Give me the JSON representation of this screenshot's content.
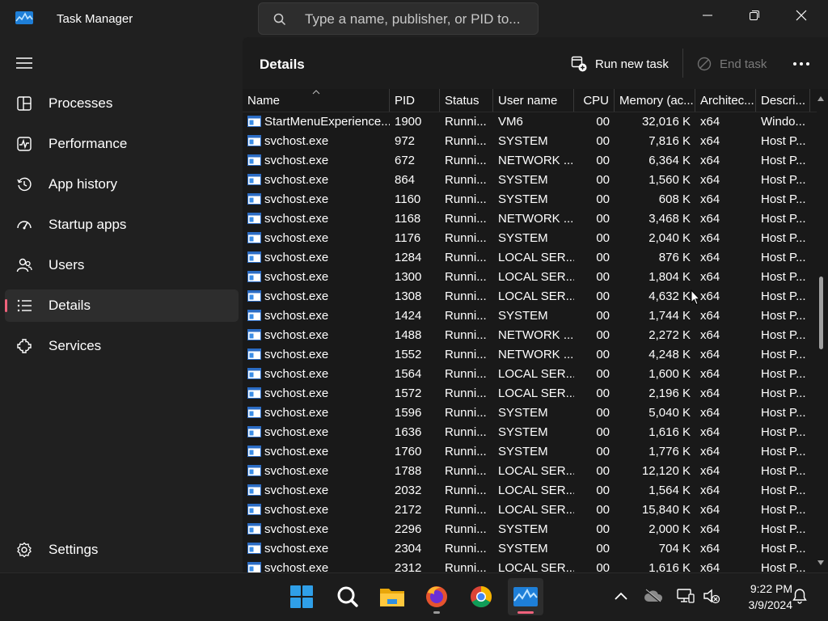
{
  "window": {
    "title": "Task Manager",
    "search_placeholder": "Type a name, publisher, or PID to...",
    "controls": [
      "minimize",
      "restore",
      "close"
    ]
  },
  "sidebar": {
    "items": [
      {
        "label": "Processes",
        "icon": "processes-icon",
        "active": false
      },
      {
        "label": "Performance",
        "icon": "performance-icon",
        "active": false
      },
      {
        "label": "App history",
        "icon": "app-history-icon",
        "active": false
      },
      {
        "label": "Startup apps",
        "icon": "startup-apps-icon",
        "active": false
      },
      {
        "label": "Users",
        "icon": "users-icon",
        "active": false
      },
      {
        "label": "Details",
        "icon": "details-icon",
        "active": true
      },
      {
        "label": "Services",
        "icon": "services-icon",
        "active": false
      }
    ],
    "settings_label": "Settings"
  },
  "main": {
    "title": "Details",
    "run_new_task_label": "Run new task",
    "end_task_label": "End task",
    "more_icon": "more-icon"
  },
  "table": {
    "columns": [
      "Name",
      "PID",
      "Status",
      "User name",
      "CPU",
      "Memory (ac...",
      "Architec...",
      "Descri..."
    ],
    "rows": [
      [
        "StartMenuExperience...",
        "1900",
        "Runni...",
        "VM6",
        "00",
        "32,016 K",
        "x64",
        "Windo..."
      ],
      [
        "svchost.exe",
        "972",
        "Runni...",
        "SYSTEM",
        "00",
        "7,816 K",
        "x64",
        "Host P..."
      ],
      [
        "svchost.exe",
        "672",
        "Runni...",
        "NETWORK ...",
        "00",
        "6,364 K",
        "x64",
        "Host P..."
      ],
      [
        "svchost.exe",
        "864",
        "Runni...",
        "SYSTEM",
        "00",
        "1,560 K",
        "x64",
        "Host P..."
      ],
      [
        "svchost.exe",
        "1160",
        "Runni...",
        "SYSTEM",
        "00",
        "608 K",
        "x64",
        "Host P..."
      ],
      [
        "svchost.exe",
        "1168",
        "Runni...",
        "NETWORK ...",
        "00",
        "3,468 K",
        "x64",
        "Host P..."
      ],
      [
        "svchost.exe",
        "1176",
        "Runni...",
        "SYSTEM",
        "00",
        "2,040 K",
        "x64",
        "Host P..."
      ],
      [
        "svchost.exe",
        "1284",
        "Runni...",
        "LOCAL SER...",
        "00",
        "876 K",
        "x64",
        "Host P..."
      ],
      [
        "svchost.exe",
        "1300",
        "Runni...",
        "LOCAL SER...",
        "00",
        "1,804 K",
        "x64",
        "Host P..."
      ],
      [
        "svchost.exe",
        "1308",
        "Runni...",
        "LOCAL SER...",
        "00",
        "4,632 K",
        "x64",
        "Host P..."
      ],
      [
        "svchost.exe",
        "1424",
        "Runni...",
        "SYSTEM",
        "00",
        "1,744 K",
        "x64",
        "Host P..."
      ],
      [
        "svchost.exe",
        "1488",
        "Runni...",
        "NETWORK ...",
        "00",
        "2,272 K",
        "x64",
        "Host P..."
      ],
      [
        "svchost.exe",
        "1552",
        "Runni...",
        "NETWORK ...",
        "00",
        "4,248 K",
        "x64",
        "Host P..."
      ],
      [
        "svchost.exe",
        "1564",
        "Runni...",
        "LOCAL SER...",
        "00",
        "1,600 K",
        "x64",
        "Host P..."
      ],
      [
        "svchost.exe",
        "1572",
        "Runni...",
        "LOCAL SER...",
        "00",
        "2,196 K",
        "x64",
        "Host P..."
      ],
      [
        "svchost.exe",
        "1596",
        "Runni...",
        "SYSTEM",
        "00",
        "5,040 K",
        "x64",
        "Host P..."
      ],
      [
        "svchost.exe",
        "1636",
        "Runni...",
        "SYSTEM",
        "00",
        "1,616 K",
        "x64",
        "Host P..."
      ],
      [
        "svchost.exe",
        "1760",
        "Runni...",
        "SYSTEM",
        "00",
        "1,776 K",
        "x64",
        "Host P..."
      ],
      [
        "svchost.exe",
        "1788",
        "Runni...",
        "LOCAL SER...",
        "00",
        "12,120 K",
        "x64",
        "Host P..."
      ],
      [
        "svchost.exe",
        "2032",
        "Runni...",
        "LOCAL SER...",
        "00",
        "1,564 K",
        "x64",
        "Host P..."
      ],
      [
        "svchost.exe",
        "2172",
        "Runni...",
        "LOCAL SER...",
        "00",
        "15,840 K",
        "x64",
        "Host P..."
      ],
      [
        "svchost.exe",
        "2296",
        "Runni...",
        "SYSTEM",
        "00",
        "2,000 K",
        "x64",
        "Host P..."
      ],
      [
        "svchost.exe",
        "2304",
        "Runni...",
        "SYSTEM",
        "00",
        "704 K",
        "x64",
        "Host P..."
      ],
      [
        "svchost.exe",
        "2312",
        "Runni...",
        "LOCAL SER...",
        "00",
        "1,616 K",
        "x64",
        "Host P..."
      ]
    ]
  },
  "taskbar": {
    "apps": [
      {
        "icon": "windows-start-icon",
        "active": false
      },
      {
        "icon": "search-icon",
        "active": false
      },
      {
        "icon": "file-explorer-icon",
        "active": false
      },
      {
        "icon": "firefox-icon",
        "active": false
      },
      {
        "icon": "chrome-icon",
        "active": false
      },
      {
        "icon": "task-manager-icon",
        "active": true
      }
    ],
    "tray_icons": [
      "chevron-up-icon",
      "onedrive-icon",
      "network-icon",
      "volume-muted-icon",
      "notifications-icon"
    ],
    "time": "9:22 PM",
    "date": "3/9/2024"
  },
  "colors": {
    "accent": "#f0627c",
    "background": "#191919",
    "sidebar": "#202020",
    "text": "#ffffff",
    "muted_text": "#7a7a7a"
  }
}
